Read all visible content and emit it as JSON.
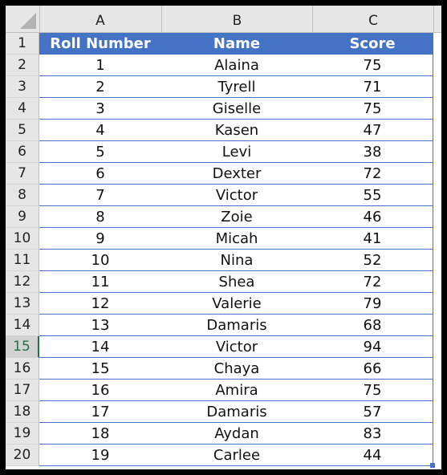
{
  "sheet": {
    "column_headers": [
      "A",
      "B",
      "C"
    ],
    "table_header": {
      "roll": "Roll Number",
      "name": "Name",
      "score": "Score"
    },
    "header_row_number": "1",
    "active_row_number": "15",
    "accent_color": "#4472c4",
    "rows": [
      {
        "row": "2",
        "roll": "1",
        "name": "Alaina",
        "score": "75"
      },
      {
        "row": "3",
        "roll": "2",
        "name": "Tyrell",
        "score": "71"
      },
      {
        "row": "4",
        "roll": "3",
        "name": "Giselle",
        "score": "75"
      },
      {
        "row": "5",
        "roll": "4",
        "name": "Kasen",
        "score": "47"
      },
      {
        "row": "6",
        "roll": "5",
        "name": "Levi",
        "score": "38"
      },
      {
        "row": "7",
        "roll": "6",
        "name": "Dexter",
        "score": "72"
      },
      {
        "row": "8",
        "roll": "7",
        "name": "Victor",
        "score": "55"
      },
      {
        "row": "9",
        "roll": "8",
        "name": "Zoie",
        "score": "46"
      },
      {
        "row": "10",
        "roll": "9",
        "name": "Micah",
        "score": "41"
      },
      {
        "row": "11",
        "roll": "10",
        "name": "Nina",
        "score": "52"
      },
      {
        "row": "12",
        "roll": "11",
        "name": "Shea",
        "score": "72"
      },
      {
        "row": "13",
        "roll": "12",
        "name": "Valerie",
        "score": "79"
      },
      {
        "row": "14",
        "roll": "13",
        "name": "Damaris",
        "score": "68"
      },
      {
        "row": "15",
        "roll": "14",
        "name": "Victor",
        "score": "94"
      },
      {
        "row": "16",
        "roll": "15",
        "name": "Chaya",
        "score": "66"
      },
      {
        "row": "17",
        "roll": "16",
        "name": "Amira",
        "score": "75"
      },
      {
        "row": "18",
        "roll": "17",
        "name": "Damaris",
        "score": "57"
      },
      {
        "row": "19",
        "roll": "18",
        "name": "Aydan",
        "score": "83"
      },
      {
        "row": "20",
        "roll": "19",
        "name": "Carlee",
        "score": "44"
      }
    ]
  }
}
